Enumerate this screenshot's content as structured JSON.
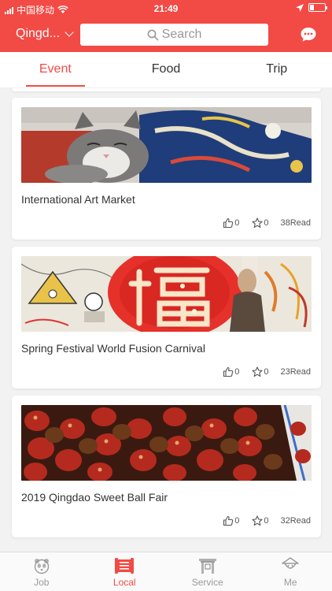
{
  "status_bar": {
    "carrier": "中国移动",
    "time": "21:49"
  },
  "header": {
    "city": "Qingd...",
    "search_placeholder": "Search"
  },
  "tabs": [
    {
      "label": "Event",
      "active": true
    },
    {
      "label": "Food",
      "active": false
    },
    {
      "label": "Trip",
      "active": false
    }
  ],
  "cards": [
    {
      "title": "International Art Market",
      "likes": "0",
      "stars": "0",
      "reads": "38Read"
    },
    {
      "title": "Spring Festival World Fusion Carnival",
      "likes": "0",
      "stars": "0",
      "reads": "23Read"
    },
    {
      "title": "2019 Qingdao Sweet Ball Fair",
      "likes": "0",
      "stars": "0",
      "reads": "32Read"
    }
  ],
  "bottom_nav": [
    {
      "label": "Job",
      "icon": "panda-icon",
      "active": false
    },
    {
      "label": "Local",
      "icon": "scroll-icon",
      "active": true
    },
    {
      "label": "Service",
      "icon": "gate-icon",
      "active": false
    },
    {
      "label": "Me",
      "icon": "person-hat-icon",
      "active": false
    }
  ],
  "colors": {
    "accent": "#f24a45",
    "inactive": "#9a9a9a"
  }
}
